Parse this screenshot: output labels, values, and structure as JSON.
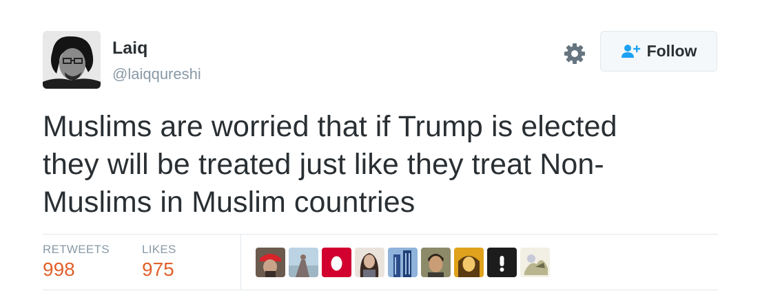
{
  "user": {
    "name": "Laiq",
    "handle": "@laiqqureshi"
  },
  "follow_button": {
    "label": "Follow"
  },
  "tweet": {
    "lines": [
      "Muslims are worried that if Trump is elected",
      "they will be treated just like they treat Non-",
      "Muslims in Muslim countries"
    ]
  },
  "stats": {
    "retweets_label": "RETWEETS",
    "retweets_value": "998",
    "likes_label": "LIKES",
    "likes_value": "975"
  },
  "colors": {
    "text": "#292f33",
    "secondary": "#8899a6",
    "stat_value": "#e0602b",
    "follow_icon": "#1da1f2",
    "divider": "#e1e8ed"
  },
  "likers": [
    {
      "name": "liker-avatar-red-cap"
    },
    {
      "name": "liker-avatar-landscape"
    },
    {
      "name": "liker-avatar-egg"
    },
    {
      "name": "liker-avatar-woman"
    },
    {
      "name": "liker-avatar-buildings"
    },
    {
      "name": "liker-avatar-man"
    },
    {
      "name": "liker-avatar-yellow"
    },
    {
      "name": "liker-avatar-dark"
    },
    {
      "name": "liker-avatar-cartoon"
    }
  ]
}
